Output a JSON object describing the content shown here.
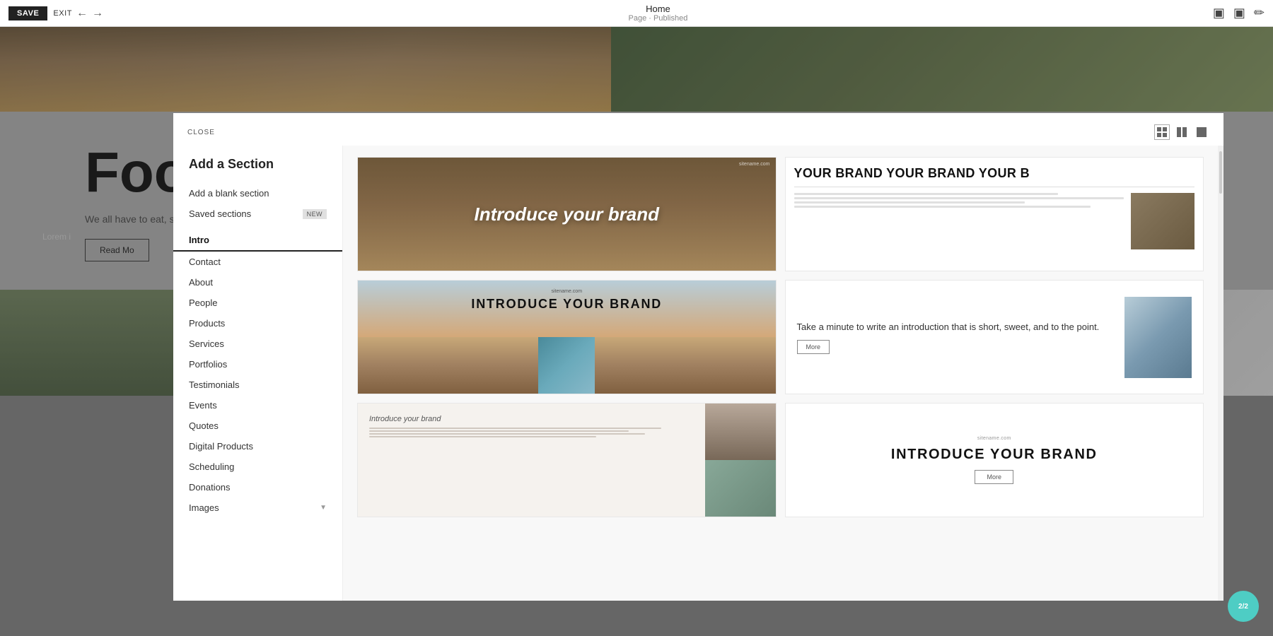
{
  "toolbar": {
    "save_label": "SAVE",
    "exit_label": "EXIT",
    "page_title": "Home",
    "page_status": "Page · Published"
  },
  "modal": {
    "close_label": "CLOSE",
    "title": "Add a Section",
    "sidebar_items": [
      {
        "id": "add-blank",
        "label": "Add a blank section",
        "badge": null
      },
      {
        "id": "saved",
        "label": "Saved sections",
        "badge": "NEW"
      },
      {
        "id": "intro",
        "label": "Intro",
        "active": true
      },
      {
        "id": "contact",
        "label": "Contact",
        "active": false
      },
      {
        "id": "about",
        "label": "About",
        "active": false
      },
      {
        "id": "people",
        "label": "People",
        "active": false
      },
      {
        "id": "products",
        "label": "Products",
        "active": false
      },
      {
        "id": "services",
        "label": "Services",
        "active": false
      },
      {
        "id": "portfolios",
        "label": "Portfolios",
        "active": false
      },
      {
        "id": "testimonials",
        "label": "Testimonials",
        "active": false
      },
      {
        "id": "events",
        "label": "Events",
        "active": false
      },
      {
        "id": "quotes",
        "label": "Quotes",
        "active": false
      },
      {
        "id": "digital-products",
        "label": "Digital Products",
        "active": false
      },
      {
        "id": "scheduling",
        "label": "Scheduling",
        "active": false
      },
      {
        "id": "donations",
        "label": "Donations",
        "active": false
      },
      {
        "id": "images",
        "label": "Images",
        "active": false
      }
    ],
    "templates": [
      {
        "id": "tmpl1",
        "type": "image-text",
        "main_text": "Introduce your brand"
      },
      {
        "id": "tmpl2",
        "type": "text-image",
        "header_text": "YOUR BRAND  YOUR BRAND  YOUR B"
      },
      {
        "id": "tmpl3",
        "type": "landscape-text",
        "title_text": "INTRODUCE YOUR\nBRAND"
      },
      {
        "id": "tmpl4",
        "type": "text-image-right",
        "body_text": "Take a minute to write an introduction that is short, sweet, and to the point.",
        "btn_label": "More"
      },
      {
        "id": "tmpl5",
        "type": "split-image",
        "intro_text": "Introduce your brand"
      },
      {
        "id": "tmpl6",
        "type": "centered-text",
        "title_text": "INTRODUCE YOUR\nBRAND",
        "btn_label": "More"
      }
    ]
  },
  "page_bg": {
    "food_title": "Food",
    "food_desc": "We all have to eat, so w",
    "read_more": "Read Mo",
    "lorem_text": "Lorem i"
  },
  "badge": {
    "label": "2/2"
  }
}
